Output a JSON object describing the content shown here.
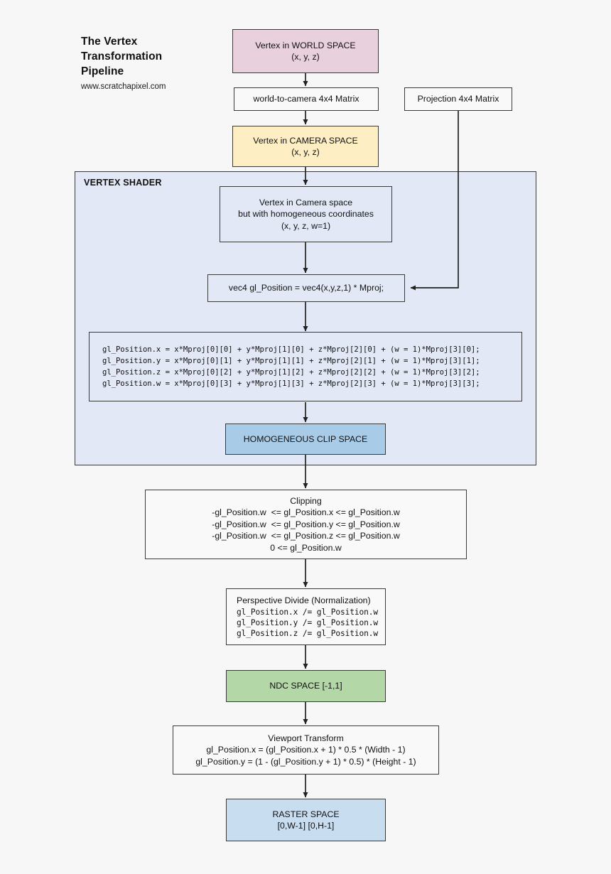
{
  "title": {
    "line1": "The Vertex",
    "line2": "Transformation",
    "line3": "Pipeline",
    "url": "www.scratchapixel.com"
  },
  "colors": {
    "world_space": "#e8d0dd",
    "camera_space": "#fdeec4",
    "clip_space": "#a8cbe8",
    "ndc_space": "#b4d7a8",
    "raster_space": "#c9ddf0",
    "shader_panel": "#e2e8f6",
    "plain_box": "#f9f9f9",
    "border": "#3a3a3a",
    "background": "#f7f7f7"
  },
  "nodes": {
    "world_space": {
      "line1": "Vertex in WORLD SPACE",
      "line2": "(x, y, z)"
    },
    "world_to_camera_matrix": {
      "line1": "world-to-camera 4x4 Matrix"
    },
    "projection_matrix": {
      "line1": "Projection 4x4 Matrix"
    },
    "camera_space": {
      "line1": "Vertex in CAMERA SPACE",
      "line2": "(x, y, z)"
    },
    "vertex_shader": {
      "label": "VERTEX SHADER"
    },
    "homogeneous_vertex": {
      "line1": "Vertex in Camera space",
      "line2": "but with homogeneous coordinates",
      "line3": "(x, y, z, w=1)"
    },
    "gl_position_assign": {
      "line1": "vec4 gl_Position = vec4(x,y,z,1) * Mproj;"
    },
    "matrix_code": {
      "line1": "gl_Position.x = x*Mproj[0][0] + y*Mproj[1][0] + z*Mproj[2][0] + (w = 1)*Mproj[3][0];",
      "line2": "gl_Position.y = x*Mproj[0][1] + y*Mproj[1][1] + z*Mproj[2][1] + (w = 1)*Mproj[3][1];",
      "line3": "gl_Position.z = x*Mproj[0][2] + y*Mproj[1][2] + z*Mproj[2][2] + (w = 1)*Mproj[3][2];",
      "line4": "gl_Position.w = x*Mproj[0][3] + y*Mproj[1][3] + z*Mproj[2][3] + (w = 1)*Mproj[3][3];"
    },
    "clip_space": {
      "line1": "HOMOGENEOUS CLIP SPACE"
    },
    "clipping": {
      "line1": "Clipping",
      "line2": "-gl_Position.w  <= gl_Position.x <= gl_Position.w",
      "line3": "-gl_Position.w  <= gl_Position.y <= gl_Position.w",
      "line4": "-gl_Position.w  <= gl_Position.z <= gl_Position.w",
      "line5": "0 <= gl_Position.w"
    },
    "perspective_divide": {
      "line1": "Perspective Divide (Normalization)",
      "line2": "gl_Position.x /= gl_Position.w",
      "line3": "gl_Position.y /= gl_Position.w",
      "line4": "gl_Position.z /= gl_Position.w"
    },
    "ndc_space": {
      "line1": "NDC SPACE [-1,1]"
    },
    "viewport_transform": {
      "line1": "Viewport Transform",
      "line2": "gl_Position.x = (gl_Position.x + 1) * 0.5 * (Width - 1)",
      "line3": "gl_Position.y = (1 - (gl_Position.y + 1) * 0.5) * (Height - 1)"
    },
    "raster_space": {
      "line1": "RASTER SPACE",
      "line2": "[0,W-1] [0,H-1]"
    }
  }
}
